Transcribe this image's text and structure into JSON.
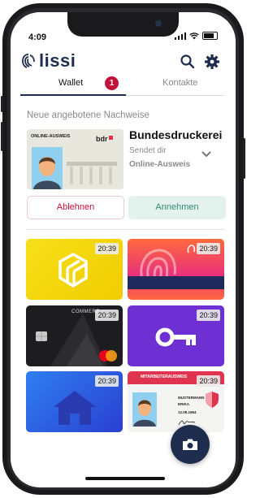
{
  "status_bar": {
    "time": "4:09"
  },
  "app": {
    "name": "lissi"
  },
  "tabs": [
    {
      "label": "Wallet",
      "badge": "1",
      "active": true
    },
    {
      "label": "Kontakte",
      "active": false
    }
  ],
  "offers": {
    "section_title": "Neue angebotene Nachweise",
    "item": {
      "card_label": "ONLINE-AUSWEIS",
      "issuer": "Bundesdruckerei",
      "subtitle": "Sendet dir",
      "document": "Online-Ausweis"
    },
    "reject_label": "Ablehnen",
    "accept_label": "Annehmen"
  },
  "wallet_cards": [
    {
      "icon": "box-logo-icon",
      "time": "20:39",
      "color": "#f5d800"
    },
    {
      "icon": "fingerprint-icon",
      "time": "20:39",
      "color": "#f0504a"
    },
    {
      "icon": "credit-card",
      "time": "20:39",
      "label": "COMMERZ",
      "color": "#1d1d1f"
    },
    {
      "icon": "key-icon",
      "time": "20:39",
      "color": "#6e2fd3"
    },
    {
      "icon": "house-icon",
      "time": "20:39",
      "color": "#2f6ee8"
    },
    {
      "icon": "id-card",
      "time": "20:39",
      "header": "MITARBEITERAUSWEIS",
      "surname": "MUSTERMANN",
      "first_name": "ERIKA",
      "date": "12.08.1964",
      "color": "#e0344e"
    }
  ],
  "fab": {
    "icon": "camera-icon"
  },
  "colors": {
    "brand": "#1e2d4d",
    "accent": "#c3123a",
    "accept": "#2e8a73"
  }
}
